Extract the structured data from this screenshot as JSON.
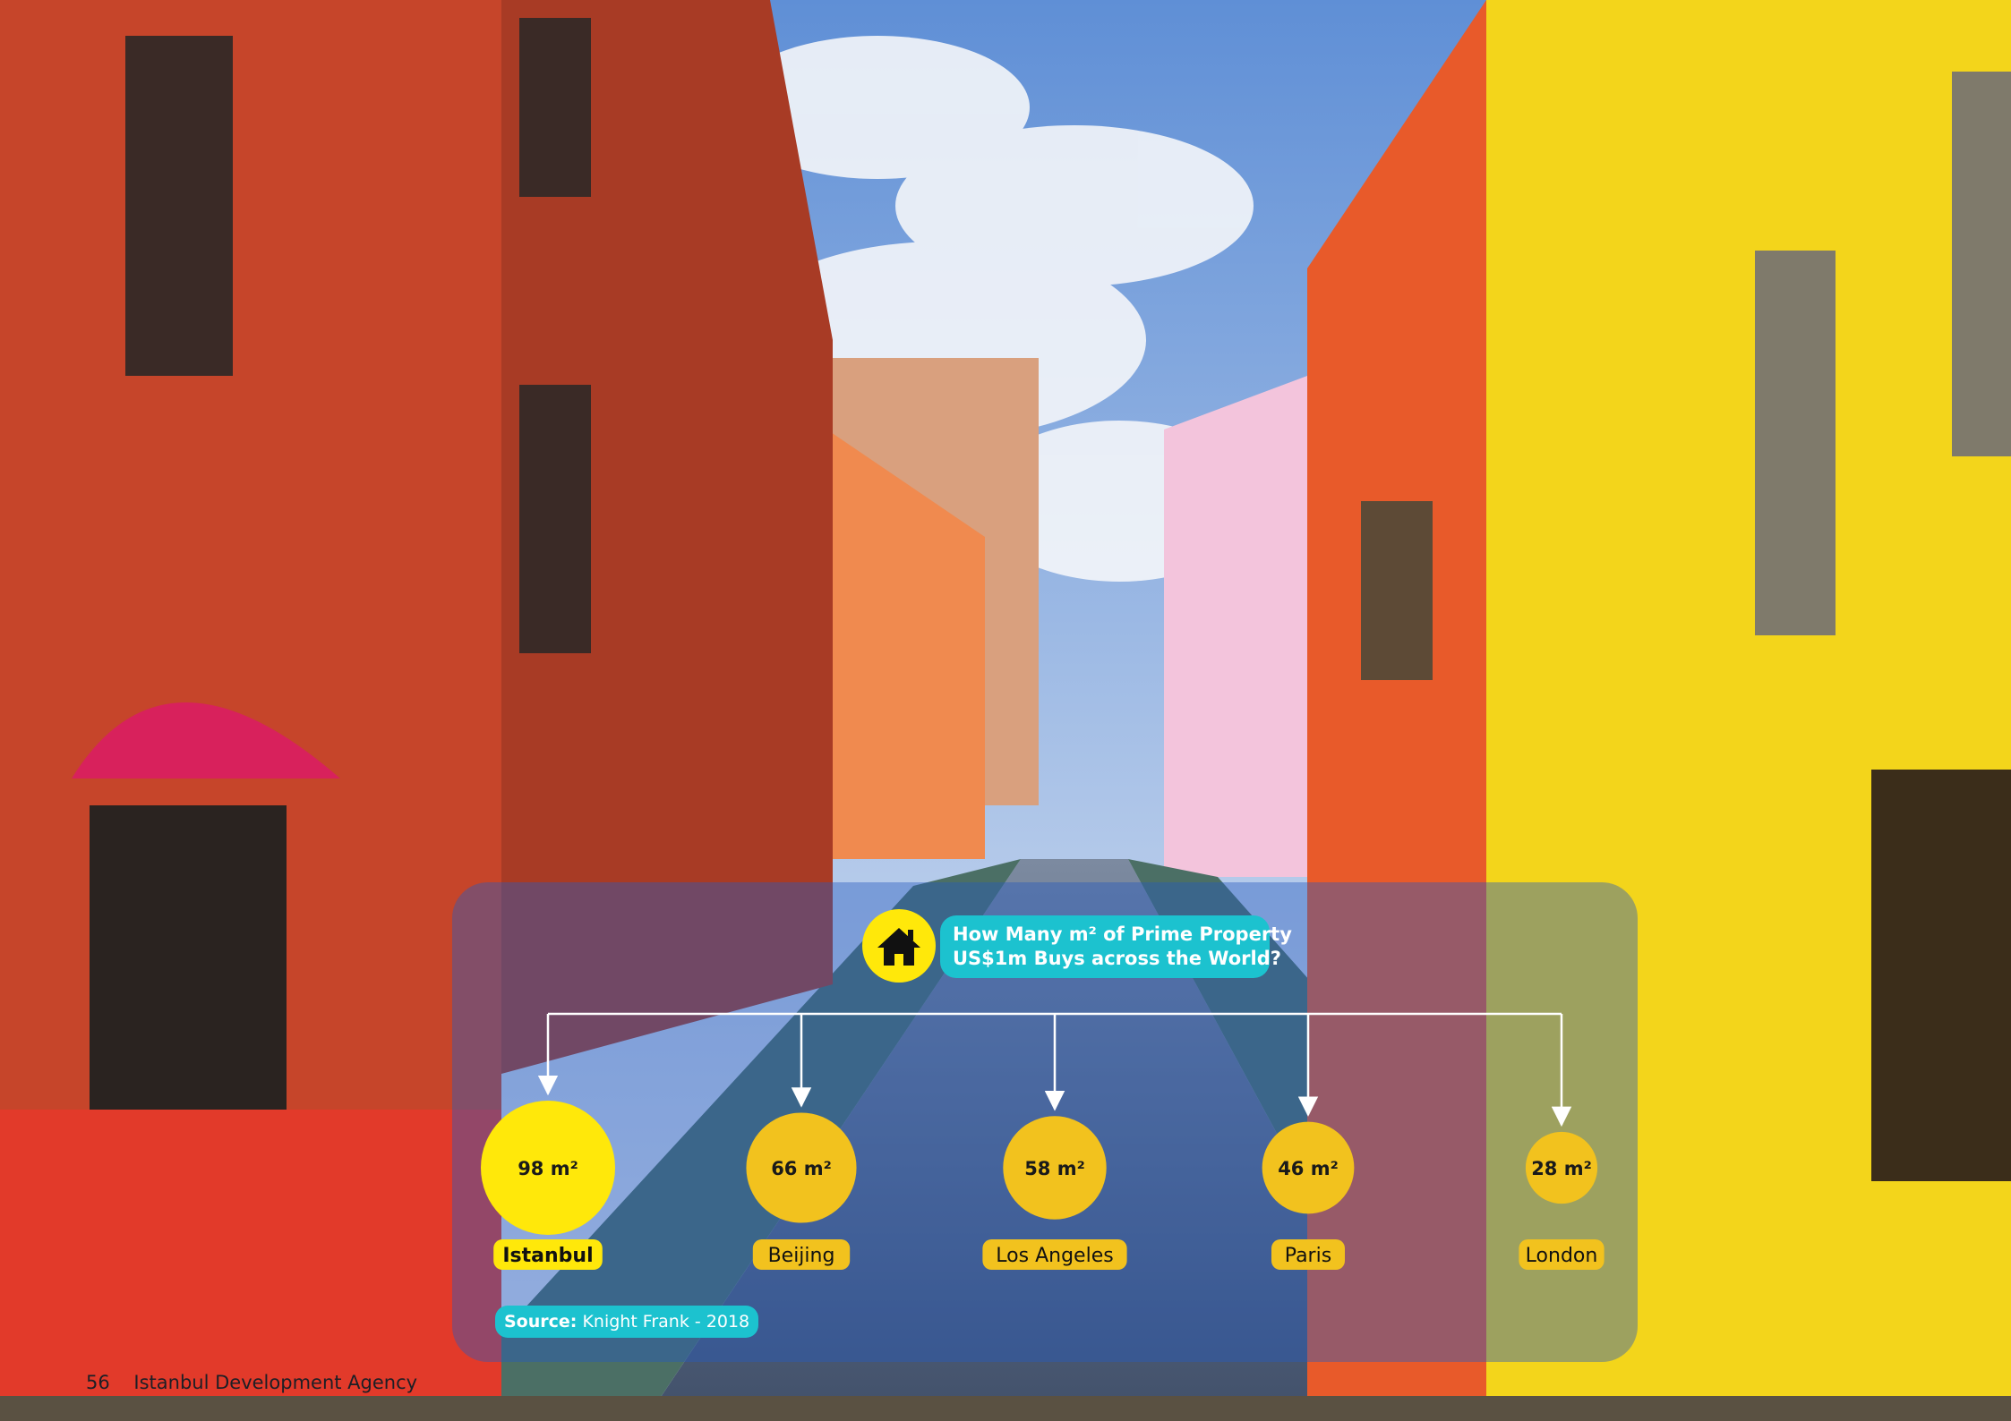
{
  "infographic": {
    "title_line1": "How Many m² of Prime Property",
    "title_line2": "US$1m Buys across the World?",
    "source_label": "Source:",
    "source_value": "Knight Frank - 2018"
  },
  "footer": {
    "page_number": "56",
    "publisher": "Istanbul Development Agency"
  },
  "colors": {
    "highlight_yellow": "#ffe80a",
    "bubble_gold": "#f2c21e",
    "accent_cyan": "#1cc2cf"
  },
  "icons": {
    "title_badge": "house-icon"
  },
  "chart_data": {
    "type": "bubble",
    "title": "How Many m² of Prime Property US$1m Buys across the World?",
    "categories": [
      "Istanbul",
      "Beijing",
      "Los Angeles",
      "Paris",
      "London"
    ],
    "values": [
      98,
      66,
      58,
      46,
      28
    ],
    "unit": "m²",
    "data_labels": [
      "98 m²",
      "66 m²",
      "58 m²",
      "46 m²",
      "28 m²"
    ],
    "highlight": "Istanbul",
    "source": "Knight Frank - 2018"
  }
}
